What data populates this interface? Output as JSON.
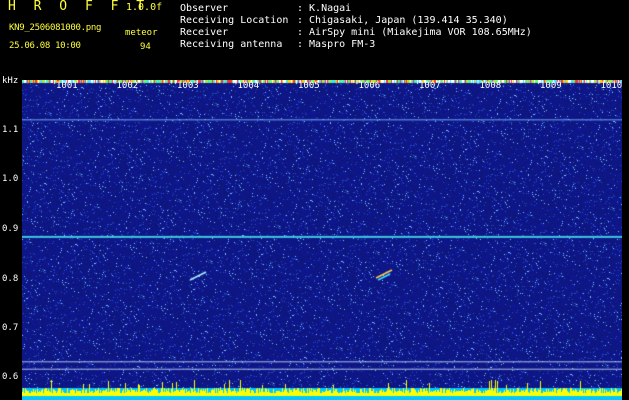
{
  "header": {
    "title": "H R O F F T",
    "version": "1.0.0f",
    "filename": "KN9_2506081000.png",
    "datetime": "25.06.08 10:00",
    "meteor_label": "meteor",
    "meteor_count": "94",
    "info": [
      {
        "label": "Observer",
        "value": ": K.Nagai"
      },
      {
        "label": "Receiving Location",
        "value": ": Chigasaki, Japan (139.414 35.340)"
      },
      {
        "label": "Receiver",
        "value": ": AirSpy mini (Miakejima VOR 108.65MHz)"
      },
      {
        "label": "Receiving antenna",
        "value": ": Maspro FM-3"
      }
    ]
  },
  "axis": {
    "unit": "kHz",
    "y_ticks": [
      "1.1",
      "1.0",
      "0.9",
      "0.8",
      "0.7",
      "0.6"
    ],
    "y_range": [
      0.58,
      1.19
    ],
    "minute_marks": [
      "1001",
      "1002",
      "1003",
      "1004",
      "1005",
      "1006",
      "1007",
      "1008",
      "1009",
      "1010"
    ]
  },
  "colors": {
    "background_noise": "#16208c",
    "carrier_line": "#3cc8e0",
    "header_text_yellow": "#ffff3c",
    "header_text_white": "#ffffff"
  }
}
